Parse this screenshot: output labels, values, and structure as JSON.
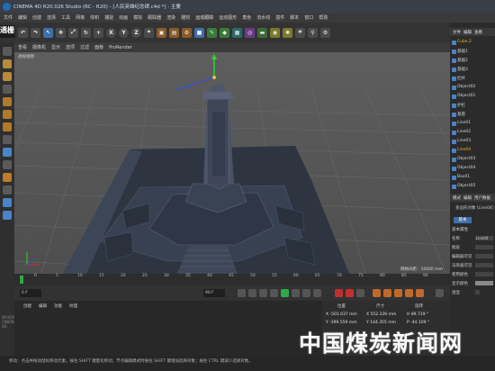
{
  "app": {
    "title": "CINEMA 4D R20.026 Studio (RC - R20) - [人民英雄纪念碑.c4d *] - 主要"
  },
  "menu": {
    "items": [
      "文件",
      "编辑",
      "创建",
      "选择",
      "工具",
      "网格",
      "体积",
      "捕捉",
      "动画",
      "模拟",
      "跟踪器",
      "渲染",
      "雕刻",
      "运动跟踪",
      "运动图形",
      "角色",
      "流水线",
      "插件",
      "脚本",
      "窗口",
      "帮助"
    ]
  },
  "sidebar_word": "通栅",
  "viewport": {
    "tabs": [
      "查看",
      "摄像机",
      "显示",
      "选项",
      "过滤",
      "面板",
      "ProRender"
    ],
    "label": "透视视图",
    "grid_distance": "网格间距：10000 mm"
  },
  "objects_panel": {
    "tabs": [
      "文件",
      "编辑",
      "查看"
    ],
    "items": [
      "Cube.2",
      "基础1",
      "基础2",
      "基础3",
      "栏杆",
      "Object02",
      "Object01",
      "护栏",
      "基座",
      "Line01",
      "Line02",
      "Line03",
      "Line04",
      "Object03",
      "Object04",
      "Box01",
      "Object05"
    ],
    "selected_index": 12
  },
  "attributes_panel": {
    "tabs": [
      "模式",
      "编辑",
      "用户数据"
    ],
    "object_label": "多边形对象 [Line04]",
    "basic_tab": "基本",
    "section": "基本属性",
    "rows": [
      "名称",
      "图层",
      "编辑器可见",
      "渲染器可见",
      "使用颜色",
      "显示颜色",
      "透显"
    ],
    "name_value": "Line04"
  },
  "timeline": {
    "ticks": [
      "0",
      "5",
      "10",
      "15",
      "20",
      "25",
      "30",
      "35",
      "40",
      "45",
      "50",
      "55",
      "60",
      "65",
      "70",
      "75",
      "80",
      "85",
      "90"
    ],
    "frame_field": "0 F",
    "end_field": "90 F"
  },
  "material_panel": {
    "tabs": [
      "创建",
      "编辑",
      "功能",
      "纹理"
    ]
  },
  "coordinates": {
    "headers": [
      "位置",
      "尺寸",
      "旋转"
    ],
    "x_values": [
      "X -501.037 mm",
      "X 552.336 mm",
      "H 89.719 °"
    ],
    "y_values": [
      "Y -399.559 mm",
      "Y 144.355 mm",
      "P -44.109 °"
    ]
  },
  "status_bar": {
    "text": "移动：点击并拖动鼠标移动元素。按住 SHIFT 键量化移动；节点编辑模式时按住 SHIFT 键增加选择对象；按住 CTRL 键减少选择对象。"
  },
  "side_logo": "MAXON CINEMA 4D",
  "watermark": "中国煤炭新闻网",
  "colors": {
    "viewport_bg": "#565656",
    "axis_x": "#d42a2a",
    "axis_y": "#2ed82e",
    "axis_z": "#2a56d4",
    "selected_item": "#f0b020",
    "accent_blue": "#3f6fa8"
  }
}
